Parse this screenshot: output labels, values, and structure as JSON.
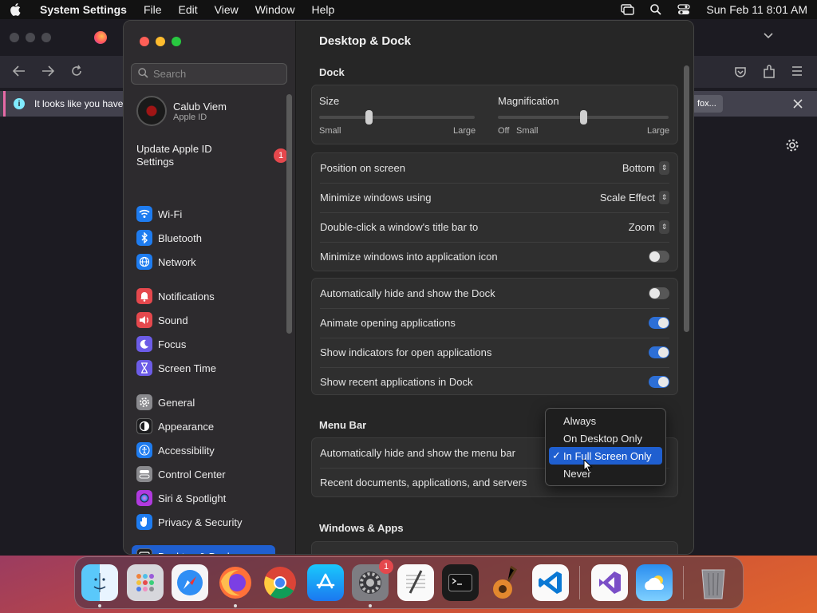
{
  "menubar": {
    "app_name": "System Settings",
    "items": [
      "File",
      "Edit",
      "View",
      "Window",
      "Help"
    ],
    "datetime": "Sun Feb 11  8:01 AM"
  },
  "browser": {
    "info_text": "It looks like you have",
    "info_button_partial": "fox..."
  },
  "sidebar": {
    "search_placeholder": "Search",
    "account_name": "Calub Viem",
    "account_sub": "Apple ID",
    "update_label": "Update Apple ID Settings",
    "update_badge": "1",
    "items": [
      {
        "label": "Wi-Fi",
        "icon": "wifi-icon",
        "color": "#1e7cf0"
      },
      {
        "label": "Bluetooth",
        "icon": "bluetooth-icon",
        "color": "#1e7cf0"
      },
      {
        "label": "Network",
        "icon": "globe-icon",
        "color": "#1e7cf0"
      },
      {
        "label": "Notifications",
        "icon": "bell-icon",
        "color": "#e5484d"
      },
      {
        "label": "Sound",
        "icon": "speaker-icon",
        "color": "#e5484d"
      },
      {
        "label": "Focus",
        "icon": "moon-icon",
        "color": "#6c5ce7"
      },
      {
        "label": "Screen Time",
        "icon": "hourglass-icon",
        "color": "#6c5ce7"
      },
      {
        "label": "General",
        "icon": "gear-icon",
        "color": "#8a8a8e"
      },
      {
        "label": "Appearance",
        "icon": "appearance-icon",
        "color": "#1c1c1e"
      },
      {
        "label": "Accessibility",
        "icon": "accessibility-icon",
        "color": "#1e7cf0"
      },
      {
        "label": "Control Center",
        "icon": "control-center-icon",
        "color": "#8a8a8e"
      },
      {
        "label": "Siri & Spotlight",
        "icon": "siri-icon",
        "color": "#b03adf"
      },
      {
        "label": "Privacy & Security",
        "icon": "hand-icon",
        "color": "#1e7cf0"
      },
      {
        "label": "Desktop & Dock",
        "icon": "dock-icon",
        "color": "#1c1c1e"
      }
    ]
  },
  "content": {
    "title": "Desktop & Dock",
    "dock_section": "Dock",
    "size_label": "Size",
    "size_min": "Small",
    "size_max": "Large",
    "size_value": 0.32,
    "mag_label": "Magnification",
    "mag_off": "Off",
    "mag_min": "Small",
    "mag_max": "Large",
    "mag_value": 0.5,
    "rows1": [
      {
        "label": "Position on screen",
        "value": "Bottom"
      },
      {
        "label": "Minimize windows using",
        "value": "Scale Effect"
      },
      {
        "label": "Double-click a window's title bar to",
        "value": "Zoom"
      },
      {
        "label": "Minimize windows into application icon",
        "toggle": false
      }
    ],
    "rows2": [
      {
        "label": "Automatically hide and show the Dock",
        "toggle": false
      },
      {
        "label": "Animate opening applications",
        "toggle": true
      },
      {
        "label": "Show indicators for open applications",
        "toggle": true
      },
      {
        "label": "Show recent applications in Dock",
        "toggle": true
      }
    ],
    "menubar_section": "Menu Bar",
    "rows3": [
      {
        "label": "Automatically hide and show the menu bar"
      },
      {
        "label": "Recent documents, applications, and servers"
      }
    ],
    "windows_section": "Windows & Apps"
  },
  "popup": {
    "options": [
      "Always",
      "On Desktop Only",
      "In Full Screen Only",
      "Never"
    ],
    "selected": "In Full Screen Only",
    "check": "✓"
  },
  "dock": {
    "apps": [
      "Finder",
      "Launchpad",
      "Safari",
      "Firefox",
      "Chrome",
      "App Store",
      "System Settings",
      "TextEdit",
      "Terminal",
      "GarageBand",
      "VS Code",
      "Visual Studio",
      "Weather",
      "Trash"
    ],
    "settings_badge": "1"
  }
}
